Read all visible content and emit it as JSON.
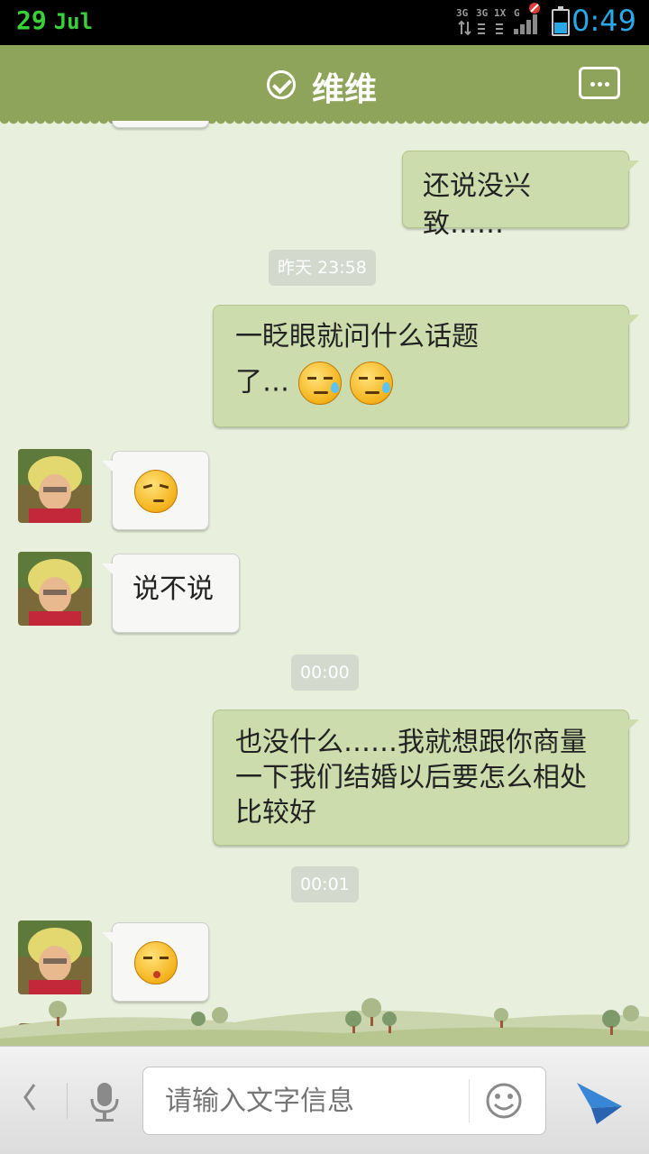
{
  "status_bar": {
    "day": "29",
    "month": "Jul",
    "network_labels": [
      "3G",
      "3G",
      "1X",
      "G"
    ],
    "time": "0:49",
    "battery_level": 0.45
  },
  "header": {
    "title": "维维",
    "icons": [
      "check-circle-icon",
      "more-icon"
    ]
  },
  "chat": {
    "m1_out": "还说没兴致……",
    "t1": "昨天 23:58",
    "m2_out_line1": "一眨眼就问什么话题",
    "m2_out_line2": "了…",
    "m3_in_emoji": "smirk-face",
    "m4_in": "说不说",
    "t2": "00:00",
    "m5_out": "也没什么……我就想跟你商量一下我们结婚以后要怎么相处比较好",
    "t3": "00:01",
    "m6_in_emoji": "shy-face"
  },
  "input_bar": {
    "placeholder": "请输入文字信息",
    "icons": [
      "back-icon",
      "mic-icon",
      "smiley-icon",
      "send-icon"
    ]
  },
  "colors": {
    "title_bar": "#8ea45a",
    "outgoing_bubble": "#cddcac",
    "incoming_bubble": "#f7f7f5",
    "background": "#e8efdc",
    "status_time": "#2aa9e8",
    "status_date": "#38d238"
  }
}
